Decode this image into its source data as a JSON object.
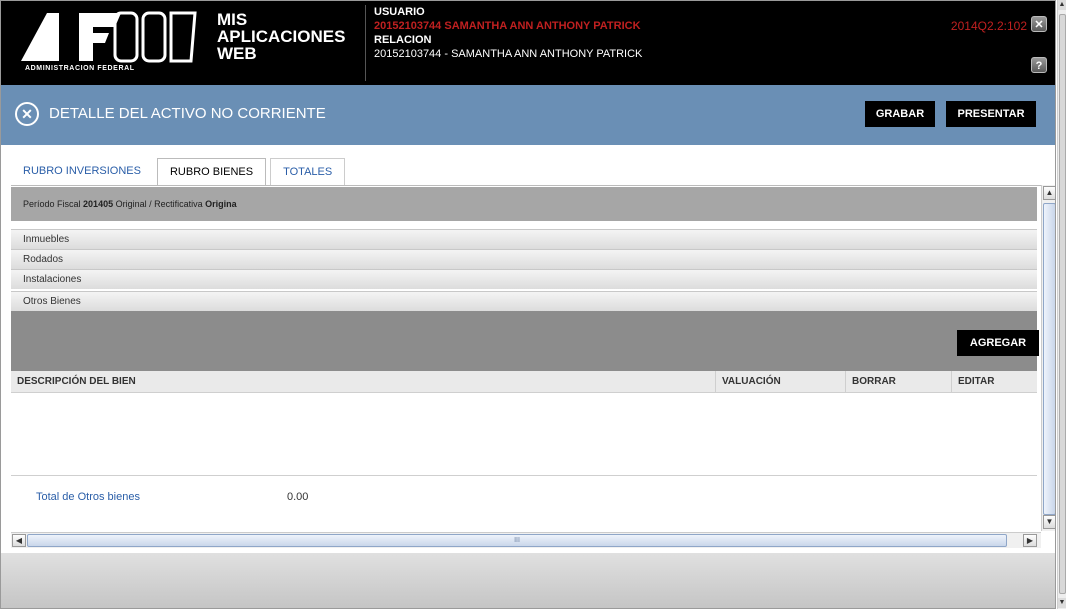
{
  "header": {
    "logo_caption": "ADMINISTRACION FEDERAL",
    "app_title_line1": "MIS",
    "app_title_line2": "APLICACIONES",
    "app_title_line3": "WEB",
    "usuario_label": "USUARIO",
    "usuario_value": "20152103744 SAMANTHA ANN ANTHONY PATRICK",
    "relacion_label": "RELACION",
    "relacion_value": "20152103744 - SAMANTHA ANN ANTHONY PATRICK",
    "version": "2014Q2.2:102",
    "close_glyph": "✕",
    "help_glyph": "?"
  },
  "titlebar": {
    "close_glyph": "✕",
    "title": "DETALLE DEL ACTIVO NO CORRIENTE",
    "grabar_label": "GRABAR",
    "presentar_label": "PRESENTAR"
  },
  "tabs": [
    {
      "label": "RUBRO INVERSIONES"
    },
    {
      "label": "RUBRO BIENES"
    },
    {
      "label": "TOTALES"
    }
  ],
  "periodo": {
    "label_fiscal": "Período Fiscal",
    "fiscal_value": "201405",
    "label_tipo": "Original / Rectificativa",
    "tipo_value": "Origina"
  },
  "sections": [
    {
      "label": "Inmuebles"
    },
    {
      "label": "Rodados"
    },
    {
      "label": "Instalaciones"
    },
    {
      "label": "Otros Bienes"
    }
  ],
  "agregar_label": "AGREGAR",
  "table": {
    "columns": [
      "DESCRIPCIÓN DEL BIEN",
      "VALUACIÓN",
      "BORRAR",
      "EDITAR"
    ]
  },
  "total": {
    "label": "Total de Otros bienes",
    "value": "0.00"
  },
  "scroll": {
    "up": "▲",
    "down": "▼",
    "left": "◀",
    "right": "▶",
    "grip": "III"
  }
}
